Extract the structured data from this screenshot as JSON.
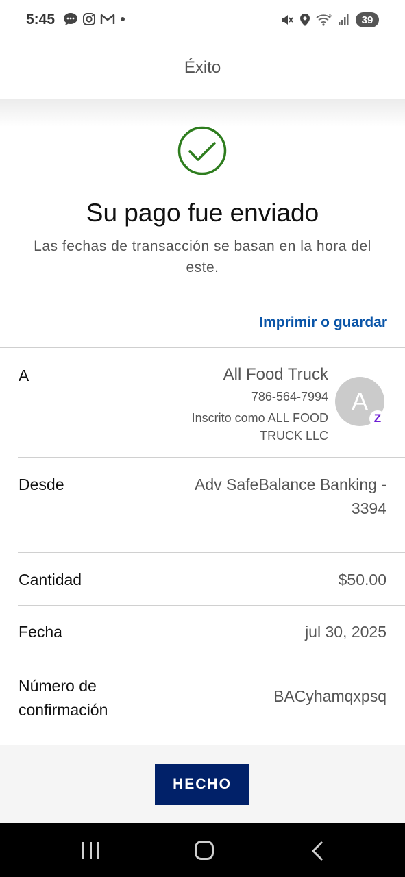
{
  "status_bar": {
    "time": "5:45",
    "battery": "39",
    "left_icons": [
      "chat-icon",
      "instagram-icon",
      "gmail-icon",
      "dot-icon"
    ],
    "right_icons": [
      "mute-icon",
      "location-icon",
      "wifi-icon",
      "signal-icon"
    ]
  },
  "header": {
    "title": "Éxito"
  },
  "success": {
    "title": "Su pago fue enviado",
    "subtitle": "Las fechas de transacción se basan en la hora del este.",
    "check_color": "#2e7d1e"
  },
  "print_link": "Imprimir o guardar",
  "details": {
    "to": {
      "label": "A",
      "name": "All Food Truck",
      "phone": "786-564-7994",
      "enrolled": "Inscrito como ALL FOOD TRUCK LLC",
      "avatar_letter": "A",
      "badge": "Z"
    },
    "from": {
      "label": "Desde",
      "value": "Adv SafeBalance Banking - 3394"
    },
    "amount": {
      "label": "Cantidad",
      "value": "$50.00"
    },
    "date": {
      "label": "Fecha",
      "value": "jul 30, 2025"
    },
    "confirmation": {
      "label": "Número de confirmación",
      "value": "BACyhamqxpsq"
    }
  },
  "done_button": "HECHO",
  "colors": {
    "primary": "#012169",
    "link": "#0a55a8",
    "zelle": "#6d1ed4"
  }
}
